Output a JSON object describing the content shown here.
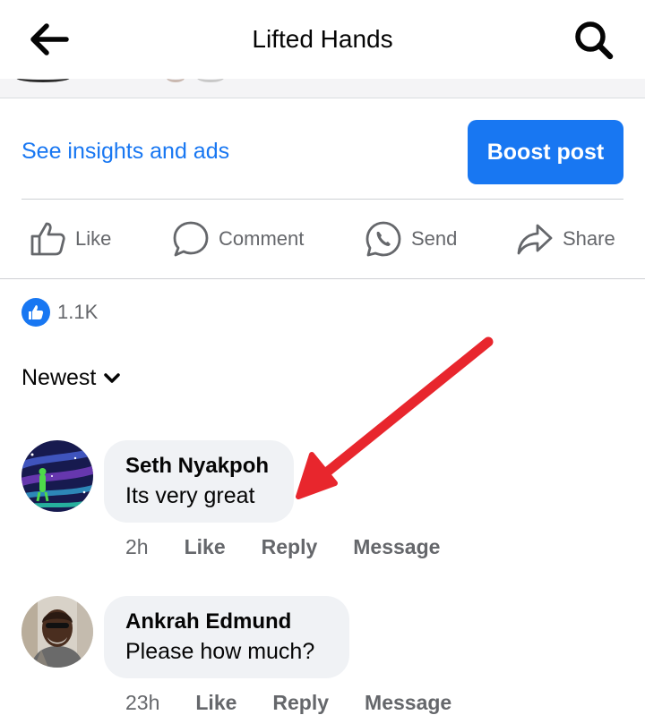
{
  "header": {
    "title": "Lifted Hands",
    "back_icon": "arrow-left-icon",
    "search_icon": "search-icon"
  },
  "post": {
    "insights_link": "See insights and ads",
    "boost_button": "Boost post",
    "actions": [
      {
        "label": "Like",
        "icon": "thumbs-up-icon"
      },
      {
        "label": "Comment",
        "icon": "comment-bubble-icon"
      },
      {
        "label": "Send",
        "icon": "whatsapp-icon"
      },
      {
        "label": "Share",
        "icon": "share-arrow-icon"
      }
    ],
    "like_count": "1.1K"
  },
  "comments_section": {
    "sort_label": "Newest",
    "comments": [
      {
        "author": "Seth Nyakpoh",
        "text": "Its very great",
        "time": "2h",
        "like_label": "Like",
        "reply_label": "Reply",
        "message_label": "Message"
      },
      {
        "author": "Ankrah Edmund",
        "text": "Please how much?",
        "time": "23h",
        "like_label": "Like",
        "reply_label": "Reply",
        "message_label": "Message"
      }
    ]
  },
  "colors": {
    "accent": "#1877f2",
    "secondary_text": "#65676b",
    "bubble": "#f0f2f5",
    "annotation_arrow": "#e8262d"
  }
}
